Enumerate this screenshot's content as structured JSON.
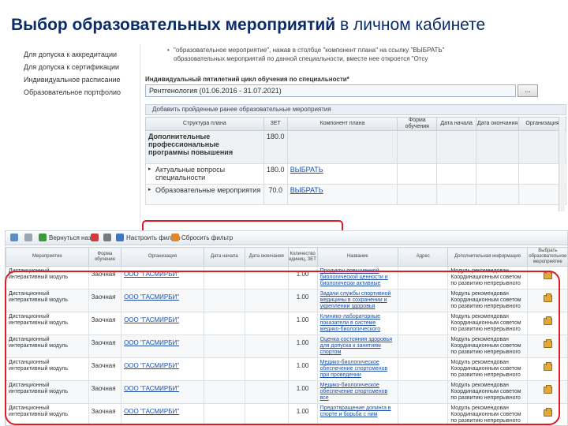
{
  "slide": {
    "title_bold": "Выбор образовательных мероприятий",
    "title_rest": "в личном кабинете"
  },
  "top": {
    "sidebar": [
      "Для допуска к аккредитации",
      "Для допуска к сертификации",
      "Индивидуальное расписание",
      "Образовательное портфолио"
    ],
    "note_line1": "\"образовательное мероприятие\", нажав в столбце \"компонент плана\" на ссылку \"ВЫБРАТЬ\"",
    "note_line2": "образовательных мероприятий по данной специальности, вместе нее откроется \"Отсу",
    "cycle_label": "Индивидуальный пятилетний цикл обучения по специальности*",
    "cycle_value": "Рентгенология (01.06.2016 - 31.07.2021)",
    "cycle_button": "...",
    "add_bar": "Добавить пройденные ранее образовательные мероприятия",
    "columns": [
      "Структура плана",
      "ЗЕТ",
      "Компонент плана",
      "Форма обучения",
      "Дата начала",
      "Дата окончания",
      "Организация"
    ],
    "rows": [
      {
        "structure": "Дополнительные профессиональные программы повышения",
        "zet": "180.0",
        "component": ""
      },
      {
        "structure": "Актуальные вопросы специальности",
        "zet": "180.0",
        "component": "ВЫБРАТЬ"
      },
      {
        "structure": "Образовательные мероприятия",
        "zet": "70.0",
        "component": "ВЫБРАТЬ"
      }
    ]
  },
  "bottom": {
    "toolbar": {
      "back": "Вернуться назад",
      "filter": "Настроить фильтр",
      "reset": "Сбросить фильтр"
    },
    "columns": [
      "Мероприятие",
      "Форма обучения",
      "Организация",
      "Дата начала",
      "Дата окончания",
      "Количество единиц, ЗЕТ",
      "Название",
      "Адрес",
      "Дополнительная информация",
      "Выбрать образовательное мероприятие"
    ],
    "rows": [
      {
        "event": "Дистанционный интерактивный модуль",
        "form": "Заочная",
        "org": "ООО \"ГАСМИРБИ\"",
        "zet": "1.00",
        "name": "Продукты повышенной биологической ценности и биологически активные",
        "info": "Модуль рекомендован Координационным советом по развитию непрерывного"
      },
      {
        "event": "Дистанционный интерактивный модуль",
        "form": "Заочная",
        "org": "ООО \"ГАСМИРБИ\"",
        "zet": "1.00",
        "name": "Задачи службы спортивной медицины в сохранении и укреплении здоровья",
        "info": "Модуль рекомендован Координационным советом по развитию непрерывного"
      },
      {
        "event": "Дистанционный интерактивный модуль",
        "form": "Заочная",
        "org": "ООО \"ГАСМИРБИ\"",
        "zet": "1.00",
        "name": "Клинико-лабораторные показатели в системе медико-биологического",
        "info": "Модуль рекомендован Координационным советом по развитию непрерывного"
      },
      {
        "event": "Дистанционный интерактивный модуль",
        "form": "Заочная",
        "org": "ООО \"ГАСМИРБИ\"",
        "zet": "1.00",
        "name": "Оценка состояния здоровья для допуска к занятиям спортом",
        "info": "Модуль рекомендован Координационным советом по развитию непрерывного"
      },
      {
        "event": "Дистанционный интерактивный модуль",
        "form": "Заочная",
        "org": "ООО \"ГАСМИРБИ\"",
        "zet": "1.00",
        "name": "Медико-биологическое обеспечение спортсменов при проведении",
        "info": "Модуль рекомендован Координационным советом по развитию непрерывного"
      },
      {
        "event": "Дистанционный интерактивный модуль",
        "form": "Заочная",
        "org": "ООО \"ГАСМИРБИ\"",
        "zet": "1.00",
        "name": "Медико-биологическое обеспечение спортсменов все",
        "info": "Модуль рекомендован Координационным советом по развитию непрерывного"
      },
      {
        "event": "Дистанционный интерактивный модуль",
        "form": "Заочная",
        "org": "ООО \"ГАСМИРБИ\"",
        "zet": "1.00",
        "name": "Предотвращение допинга в спорте и борьба с ним",
        "info": "Модуль рекомендован Координационным советом по развитию непрерывного"
      }
    ]
  }
}
